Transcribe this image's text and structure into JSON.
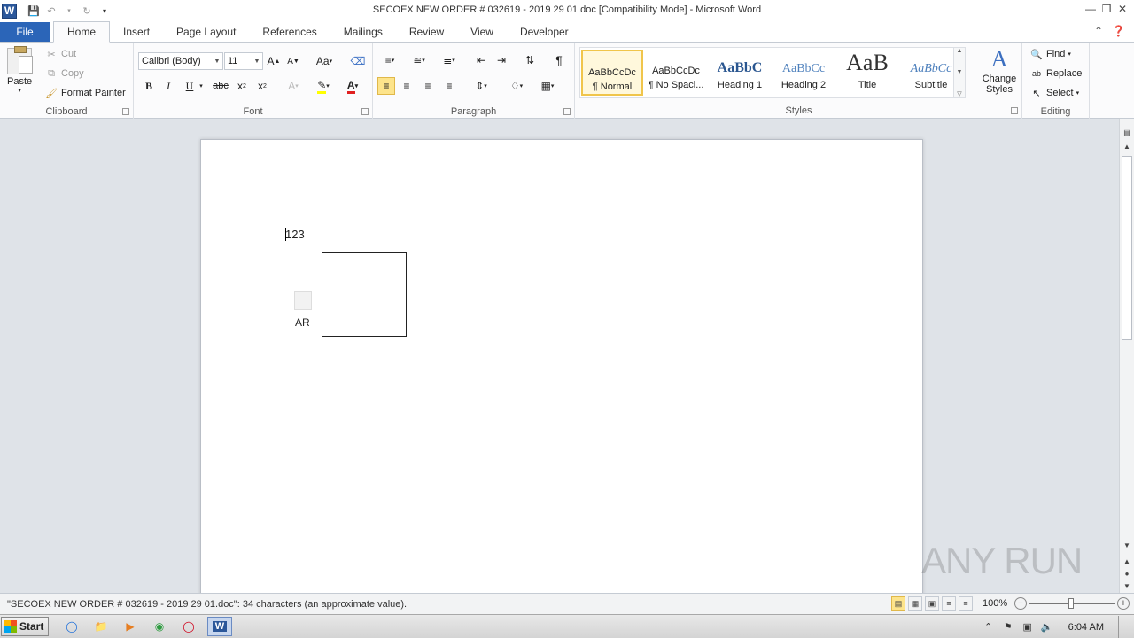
{
  "window": {
    "title": "SECOEX NEW ORDER # 032619 - 2019 29 01.doc [Compatibility Mode]  -  Microsoft Word",
    "app_icon_letter": "W"
  },
  "tabs": [
    "File",
    "Home",
    "Insert",
    "Page Layout",
    "References",
    "Mailings",
    "Review",
    "View",
    "Developer"
  ],
  "active_tab": "Home",
  "clipboard": {
    "paste": "Paste",
    "cut": "Cut",
    "copy": "Copy",
    "format_painter": "Format Painter",
    "label": "Clipboard"
  },
  "font": {
    "name": "Calibri (Body)",
    "size": "11",
    "label": "Font"
  },
  "paragraph": {
    "label": "Paragraph"
  },
  "styles": {
    "label": "Styles",
    "items": [
      {
        "sample": "AaBbCcDc",
        "name": "¶ Normal"
      },
      {
        "sample": "AaBbCcDc",
        "name": "¶ No Spaci..."
      },
      {
        "sample": "AaBbC",
        "name": "Heading 1"
      },
      {
        "sample": "AaBbCc",
        "name": "Heading 2"
      },
      {
        "sample": "AaB",
        "name": "Title"
      },
      {
        "sample": "AaBbCc",
        "name": "Subtitle"
      }
    ],
    "change_styles": "Change Styles"
  },
  "editing": {
    "label": "Editing",
    "find": "Find",
    "replace": "Replace",
    "select": "Select"
  },
  "document": {
    "text": "123",
    "embedded_label": "AR"
  },
  "watermark": "ANY RUN",
  "status": {
    "text": "\"SECOEX NEW ORDER # 032619 - 2019 29 01.doc\": 34 characters (an approximate value).",
    "zoom": "100%"
  },
  "taskbar": {
    "start": "Start",
    "clock": "6:04 AM"
  }
}
